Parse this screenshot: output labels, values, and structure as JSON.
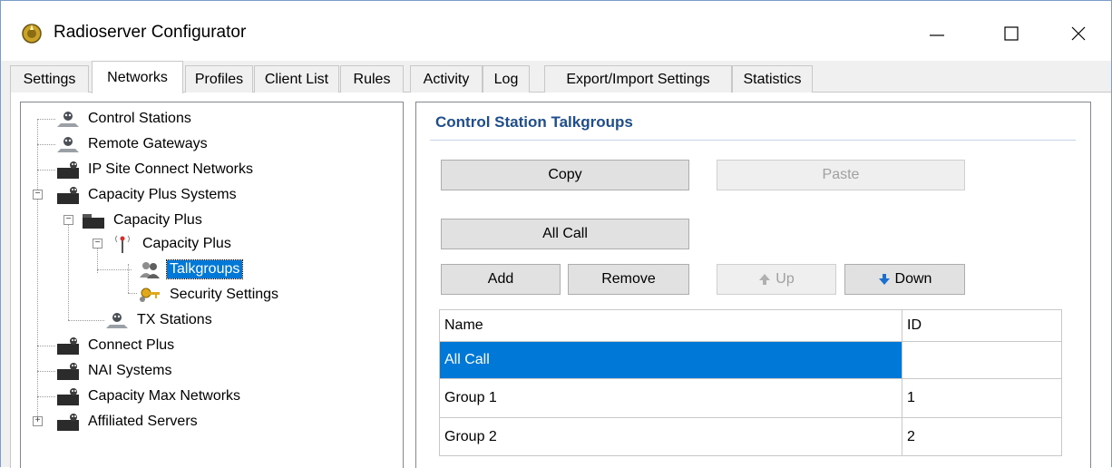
{
  "window": {
    "title": "Radioserver Configurator"
  },
  "tabs": [
    "Settings",
    "Networks",
    "Profiles",
    "Client List",
    "Rules",
    "Activity",
    "Log",
    "Export/Import Settings",
    "Statistics"
  ],
  "active_tab": "Networks",
  "tree": {
    "items": [
      {
        "label": "Control Stations",
        "icon": "base-station-icon"
      },
      {
        "label": "Remote Gateways",
        "icon": "base-station-icon"
      },
      {
        "label": "IP Site Connect Networks",
        "icon": "network-cluster-icon"
      },
      {
        "label": "Capacity Plus Systems",
        "icon": "network-cluster-icon"
      },
      {
        "label": "Capacity Plus",
        "icon": "system-icon"
      },
      {
        "label": "Capacity Plus",
        "icon": "antenna-icon"
      },
      {
        "label": "Talkgroups",
        "icon": "users-icon"
      },
      {
        "label": "Security Settings",
        "icon": "key-icon"
      },
      {
        "label": "TX Stations",
        "icon": "base-station-icon"
      },
      {
        "label": "Connect Plus",
        "icon": "network-cluster-icon"
      },
      {
        "label": "NAI Systems",
        "icon": "network-cluster-icon"
      },
      {
        "label": "Capacity Max Networks",
        "icon": "network-cluster-icon"
      },
      {
        "label": "Affiliated Servers",
        "icon": "network-cluster-icon"
      }
    ],
    "selected": "Talkgroups"
  },
  "panel": {
    "title": "Control Station Talkgroups",
    "copy_label": "Copy",
    "paste_label": "Paste",
    "allcall_label": "All Call",
    "add_label": "Add",
    "remove_label": "Remove",
    "up_label": "Up",
    "down_label": "Down"
  },
  "grid": {
    "columns": [
      "Name",
      "ID"
    ],
    "rows": [
      {
        "name": "All Call",
        "id": ""
      },
      {
        "name": "Group 1",
        "id": "1"
      },
      {
        "name": "Group 2",
        "id": "2"
      }
    ]
  },
  "colors": {
    "selection": "#0078d7",
    "panel_title": "#1f4e8c"
  }
}
